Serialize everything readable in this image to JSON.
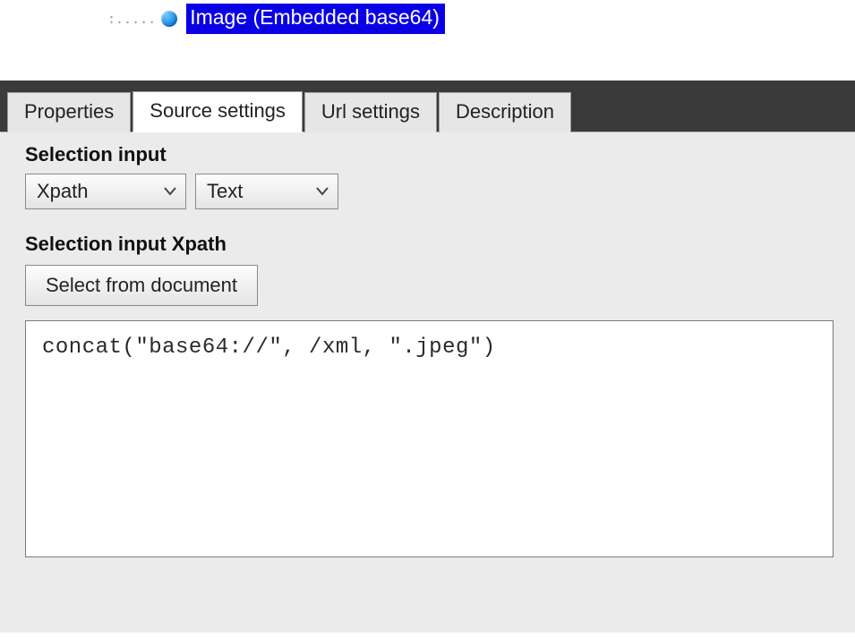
{
  "tree": {
    "selected_node_label": "Image (Embedded base64)"
  },
  "tabs": {
    "items": [
      {
        "label": "Properties",
        "active": false
      },
      {
        "label": "Source settings",
        "active": true
      },
      {
        "label": "Url settings",
        "active": false
      },
      {
        "label": "Description",
        "active": false
      }
    ]
  },
  "selection_input": {
    "title": "Selection input",
    "mode": {
      "value": "Xpath"
    },
    "type": {
      "value": "Text"
    }
  },
  "xpath_section": {
    "title": "Selection input Xpath",
    "select_button_label": "Select from document",
    "expression": "concat(\"base64://\", /xml, \".jpeg\")"
  }
}
